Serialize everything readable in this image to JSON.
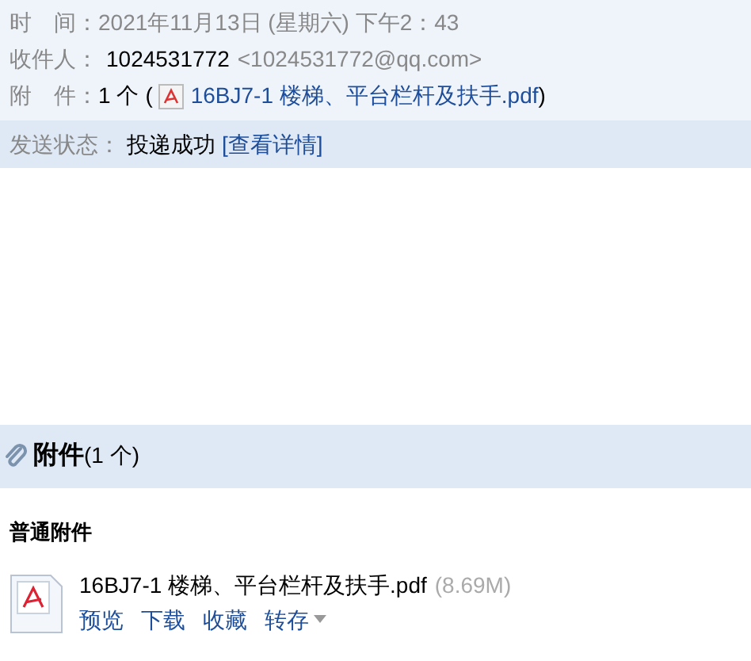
{
  "header": {
    "time": {
      "label": "时　间：",
      "value": "2021年11月13日 (星期六) 下午2：43"
    },
    "recipient": {
      "label": "收件人：",
      "name": "1024531772",
      "address": "<1024531772@qq.com>"
    },
    "attachment": {
      "label": "附　件：",
      "count": "1 个",
      "open": "(",
      "file": "16BJ7-1 楼梯、平台栏杆及扶手.pdf",
      "close": ")"
    }
  },
  "status": {
    "label": "发送状态：",
    "value": "投递成功",
    "link": "[查看详情]"
  },
  "attachments": {
    "title": "附件",
    "count": "(1 个)",
    "group": "普通附件",
    "files": [
      {
        "name": "16BJ7-1 楼梯、平台栏杆及扶手.pdf",
        "size": "(8.69M)",
        "actions": [
          {
            "label": "预览",
            "kind": "link"
          },
          {
            "label": "下载",
            "kind": "link"
          },
          {
            "label": "收藏",
            "kind": "link"
          },
          {
            "label": "转存",
            "kind": "menu"
          }
        ]
      }
    ]
  }
}
